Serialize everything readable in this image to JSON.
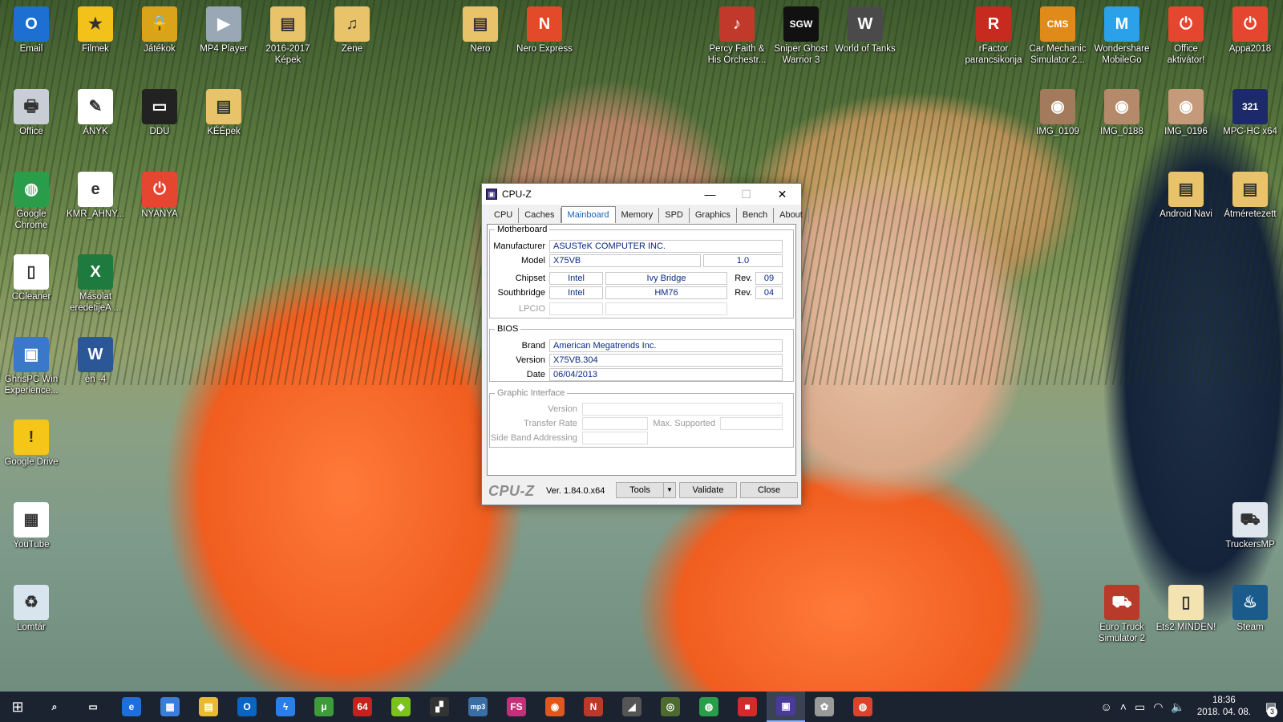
{
  "desktop": {
    "icons": [
      {
        "label": "Email",
        "icon": "outlook-icon",
        "color": "#1d6fd1",
        "glyph": "O"
      },
      {
        "label": "Filmek",
        "icon": "star-icon",
        "color": "#f2c21b",
        "glyph": "★"
      },
      {
        "label": "Játékok",
        "icon": "lock-icon",
        "color": "#d9a41a",
        "glyph": "🔒"
      },
      {
        "label": "MP4 Player",
        "icon": "disc-player-icon",
        "color": "#9aa7b4",
        "glyph": "▶"
      },
      {
        "label": "2016-2017 Képek",
        "icon": "folder-icon",
        "color": "#e8c36a",
        "glyph": "▤"
      },
      {
        "label": "Zene",
        "icon": "folder-icon",
        "color": "#e8c36a",
        "glyph": "♫"
      },
      {
        "label": "Nero",
        "icon": "folder-icon",
        "color": "#e8c36a",
        "glyph": "▤"
      },
      {
        "label": "Nero Express",
        "icon": "nero-express-icon",
        "color": "#e24a2a",
        "glyph": "N"
      },
      {
        "label": "Percy Faith & His Orchestr...",
        "icon": "music-file-icon",
        "color": "#c0392b",
        "glyph": "♪"
      },
      {
        "label": "Sniper Ghost Warrior 3",
        "icon": "game-icon",
        "color": "#111111",
        "glyph": "SGW"
      },
      {
        "label": "World of Tanks",
        "icon": "tank-icon",
        "color": "#4a4a4a",
        "glyph": "W"
      },
      {
        "label": "rFactor parancsikonja",
        "icon": "rfactor-icon",
        "color": "#c72b1f",
        "glyph": "R"
      },
      {
        "label": "Car Mechanic Simulator 2...",
        "icon": "cms-icon",
        "color": "#e08a1a",
        "glyph": "CMS"
      },
      {
        "label": "Wondershare MobileGo",
        "icon": "mobilego-icon",
        "color": "#2aa1e8",
        "glyph": "M"
      },
      {
        "label": "Office aktivátor!",
        "icon": "power-icon",
        "color": "#e5462f",
        "glyph": "⏻"
      },
      {
        "label": "Appa2018",
        "icon": "power-icon",
        "color": "#e5462f",
        "glyph": "⏻"
      },
      {
        "label": "Office",
        "icon": "printer-icon",
        "color": "#c9ced6",
        "glyph": "🖶"
      },
      {
        "label": "ÁNYK",
        "icon": "edit-icon",
        "color": "#ffffff",
        "glyph": "✎"
      },
      {
        "label": "DDU",
        "icon": "monitor-icon",
        "color": "#222222",
        "glyph": "▭"
      },
      {
        "label": "KÉÉpek",
        "icon": "folder-icon",
        "color": "#e8c36a",
        "glyph": "▤"
      },
      {
        "label": "IMG_0109",
        "icon": "photo-icon",
        "color": "#a37a5c",
        "glyph": "◉"
      },
      {
        "label": "IMG_0188",
        "icon": "photo-icon",
        "color": "#b58a6a",
        "glyph": "◉"
      },
      {
        "label": "IMG_0196",
        "icon": "photo-icon",
        "color": "#c49a7a",
        "glyph": "◉"
      },
      {
        "label": "MPC-HC x64",
        "icon": "mpc-icon",
        "color": "#1c2a6b",
        "glyph": "321"
      },
      {
        "label": "Google Chrome",
        "icon": "chrome-icon",
        "color": "#2a9d4a",
        "glyph": "◍"
      },
      {
        "label": "KMR_AHNY...",
        "icon": "pdf-icon",
        "color": "#ffffff",
        "glyph": "e"
      },
      {
        "label": "NYANYA",
        "icon": "power-icon",
        "color": "#e5462f",
        "glyph": "⏻"
      },
      {
        "label": "Android Navi",
        "icon": "folder-icon",
        "color": "#e8c36a",
        "glyph": "▤"
      },
      {
        "label": "Átméretezett",
        "icon": "folder-icon",
        "color": "#e8c36a",
        "glyph": "▤"
      },
      {
        "label": "CCleaner",
        "icon": "file-icon",
        "color": "#ffffff",
        "glyph": "▯"
      },
      {
        "label": "Másolat eredetijeA ...",
        "icon": "excel-icon",
        "color": "#1f7a3f",
        "glyph": "X"
      },
      {
        "label": "GhrisPC Win Experience...",
        "icon": "computer-icon",
        "color": "#3a79c9",
        "glyph": "▣"
      },
      {
        "label": "én -4",
        "icon": "word-icon",
        "color": "#2b5797",
        "glyph": "W"
      },
      {
        "label": "Google Drive",
        "icon": "warning-icon",
        "color": "#f5c518",
        "glyph": "!"
      },
      {
        "label": "YouTube",
        "icon": "apps-grid-icon",
        "color": "#ffffff",
        "glyph": "▦"
      },
      {
        "label": "Lomtár",
        "icon": "recycle-bin-icon",
        "color": "#d8e4ee",
        "glyph": "♻"
      },
      {
        "label": "TruckersMP",
        "icon": "truck-icon",
        "color": "#dfe6ee",
        "glyph": "⛟"
      },
      {
        "label": "Euro Truck Simulator 2",
        "icon": "truck-icon",
        "color": "#b73a2a",
        "glyph": "⛟"
      },
      {
        "label": "Ets2 MINDEN!",
        "icon": "file-icon",
        "color": "#f3e3b0",
        "glyph": "▯"
      },
      {
        "label": "Steam",
        "icon": "steam-icon",
        "color": "#1b5b8c",
        "glyph": "♨"
      }
    ]
  },
  "window": {
    "title": "CPU-Z",
    "min_label": "—",
    "max_label": "☐",
    "close_label": "✕",
    "tabs": [
      "CPU",
      "Caches",
      "Mainboard",
      "Memory",
      "SPD",
      "Graphics",
      "Bench",
      "About"
    ],
    "active_tab": "Mainboard",
    "motherboard": {
      "group": "Motherboard",
      "manufacturer_label": "Manufacturer",
      "manufacturer": "ASUSTeK COMPUTER INC.",
      "model_label": "Model",
      "model": "X75VB",
      "model_rev": "1.0",
      "chipset_label": "Chipset",
      "chipset_vendor": "Intel",
      "chipset_name": "Ivy Bridge",
      "chipset_rev_label": "Rev.",
      "chipset_rev": "09",
      "southbridge_label": "Southbridge",
      "southbridge_vendor": "Intel",
      "southbridge_name": "HM76",
      "southbridge_rev_label": "Rev.",
      "southbridge_rev": "04",
      "lpcio_label": "LPCIO"
    },
    "bios": {
      "group": "BIOS",
      "brand_label": "Brand",
      "brand": "American Megatrends Inc.",
      "version_label": "Version",
      "version": "X75VB.304",
      "date_label": "Date",
      "date": "06/04/2013"
    },
    "graphic_interface": {
      "group": "Graphic Interface",
      "version_label": "Version",
      "transfer_rate_label": "Transfer Rate",
      "max_supported_label": "Max. Supported",
      "side_band_label": "Side Band Addressing"
    },
    "footer": {
      "brand": "CPU-Z",
      "version": "Ver. 1.84.0.x64",
      "tools_label": "Tools",
      "validate_label": "Validate",
      "close_label": "Close"
    }
  },
  "taskbar": {
    "start_icon": "windows-logo-icon",
    "apps": [
      {
        "name": "search",
        "glyph": "⌕",
        "color": "#1b2230"
      },
      {
        "name": "task-view",
        "glyph": "▭",
        "color": "#1b2230"
      },
      {
        "name": "edge",
        "glyph": "e",
        "color": "#1e6fd9"
      },
      {
        "name": "store",
        "glyph": "▦",
        "color": "#3b7dd8"
      },
      {
        "name": "file-explorer",
        "glyph": "▤",
        "color": "#e8b931"
      },
      {
        "name": "outlook",
        "glyph": "O",
        "color": "#0a64c2"
      },
      {
        "name": "lightning-app",
        "glyph": "ϟ",
        "color": "#2a7ee8"
      },
      {
        "name": "utorrent",
        "glyph": "µ",
        "color": "#3d9b3a"
      },
      {
        "name": "aida64",
        "glyph": "64",
        "color": "#c6221d"
      },
      {
        "name": "green-app",
        "glyph": "◆",
        "color": "#7cc21f"
      },
      {
        "name": "video-editor",
        "glyph": "▞",
        "color": "#333333"
      },
      {
        "name": "mp3-app",
        "glyph": "mp3",
        "color": "#3a6ea5"
      },
      {
        "name": "fs-app",
        "glyph": "FS",
        "color": "#c3307a"
      },
      {
        "name": "eye-app",
        "glyph": "◉",
        "color": "#e0561f"
      },
      {
        "name": "nero-app",
        "glyph": "N",
        "color": "#b93a2a"
      },
      {
        "name": "gpu-app",
        "glyph": "◢",
        "color": "#555555"
      },
      {
        "name": "circle-app",
        "glyph": "◎",
        "color": "#4d6b2f"
      },
      {
        "name": "chrome",
        "glyph": "◍",
        "color": "#2a9d4a"
      },
      {
        "name": "red-app",
        "glyph": "■",
        "color": "#d22b2b"
      },
      {
        "name": "cpu-z",
        "glyph": "▣",
        "color": "#4a3b9a"
      },
      {
        "name": "pinwheel-app",
        "glyph": "✿",
        "color": "#9a9a9a"
      },
      {
        "name": "chrome-2",
        "glyph": "◍",
        "color": "#d9442b"
      }
    ],
    "active_app": "cpu-z",
    "clock_time": "18:36",
    "clock_date": "2018. 04. 08.",
    "notification_count": "3"
  }
}
